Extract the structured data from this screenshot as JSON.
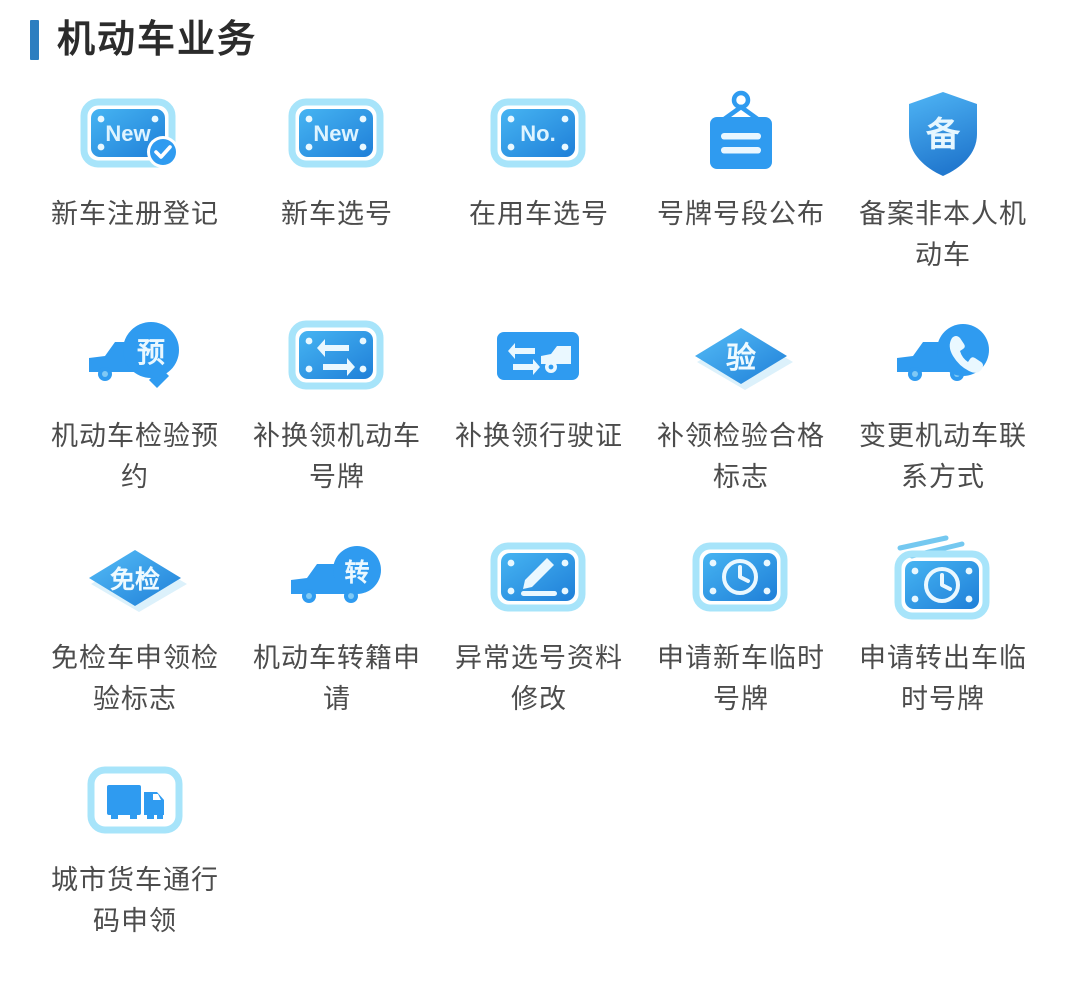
{
  "header": {
    "title": "机动车业务",
    "accent_color": "#2d7ec0"
  },
  "theme": {
    "icon_blue": "#2f9bf0",
    "icon_blue_dark": "#1f7fd8",
    "icon_blue_light": "#7fd4f5",
    "label_color": "#4c4c4c"
  },
  "services": [
    {
      "label": "新车注册登记",
      "icon": "plate-new-check-icon",
      "icon_text": "New"
    },
    {
      "label": "新车选号",
      "icon": "plate-new-icon",
      "icon_text": "New"
    },
    {
      "label": "在用车选号",
      "icon": "plate-no-icon",
      "icon_text": "No."
    },
    {
      "label": "号牌号段公布",
      "icon": "hanging-board-icon",
      "icon_text": ""
    },
    {
      "label": "备案非本人机动车",
      "icon": "shield-bei-icon",
      "icon_text": "备"
    },
    {
      "label": "机动车检验预约",
      "icon": "car-magnifier-yu-icon",
      "icon_text": "预"
    },
    {
      "label": "补换领机动车号牌",
      "icon": "plate-swap-icon",
      "icon_text": ""
    },
    {
      "label": "补换领行驶证",
      "icon": "plate-swap-car-icon",
      "icon_text": ""
    },
    {
      "label": "补领检验合格标志",
      "icon": "diamond-yan-icon",
      "icon_text": "验"
    },
    {
      "label": "变更机动车联系方式",
      "icon": "car-phone-icon",
      "icon_text": ""
    },
    {
      "label": "免检车申领检验标志",
      "icon": "diamond-mianjian-icon",
      "icon_text": "免检"
    },
    {
      "label": "机动车转籍申请",
      "icon": "car-zhuan-icon",
      "icon_text": "转"
    },
    {
      "label": "异常选号资料修改",
      "icon": "plate-pencil-icon",
      "icon_text": ""
    },
    {
      "label": "申请新车临时号牌",
      "icon": "plate-clock-icon",
      "icon_text": ""
    },
    {
      "label": "申请转出车临时号牌",
      "icon": "plate-clock-motion-icon",
      "icon_text": ""
    },
    {
      "label": "城市货车通行码申领",
      "icon": "truck-box-icon",
      "icon_text": ""
    }
  ]
}
